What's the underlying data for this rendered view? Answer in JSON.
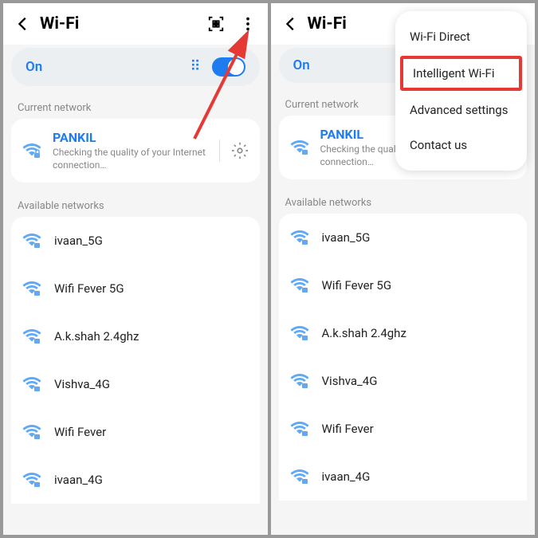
{
  "header": {
    "title": "Wi-Fi"
  },
  "toggle": {
    "label": "On"
  },
  "sections": {
    "current": "Current network",
    "available": "Available networks"
  },
  "current_network": {
    "name": "PANKIL",
    "status": "Checking the quality of your Internet connection…"
  },
  "available_networks": [
    {
      "name": "ivaan_5G"
    },
    {
      "name": "Wifi Fever 5G"
    },
    {
      "name": "A.k.shah 2.4ghz"
    },
    {
      "name": "Vishva_4G"
    },
    {
      "name": "Wifi Fever"
    },
    {
      "name": "ivaan_4G"
    }
  ],
  "dropdown": {
    "items": [
      {
        "label": "Wi-Fi Direct",
        "hl": false
      },
      {
        "label": "Intelligent Wi-Fi",
        "hl": true
      },
      {
        "label": "Advanced settings",
        "hl": false
      },
      {
        "label": "Contact us",
        "hl": false
      }
    ]
  },
  "colors": {
    "accent": "#1e7cf0",
    "highlight": "#e53935"
  }
}
